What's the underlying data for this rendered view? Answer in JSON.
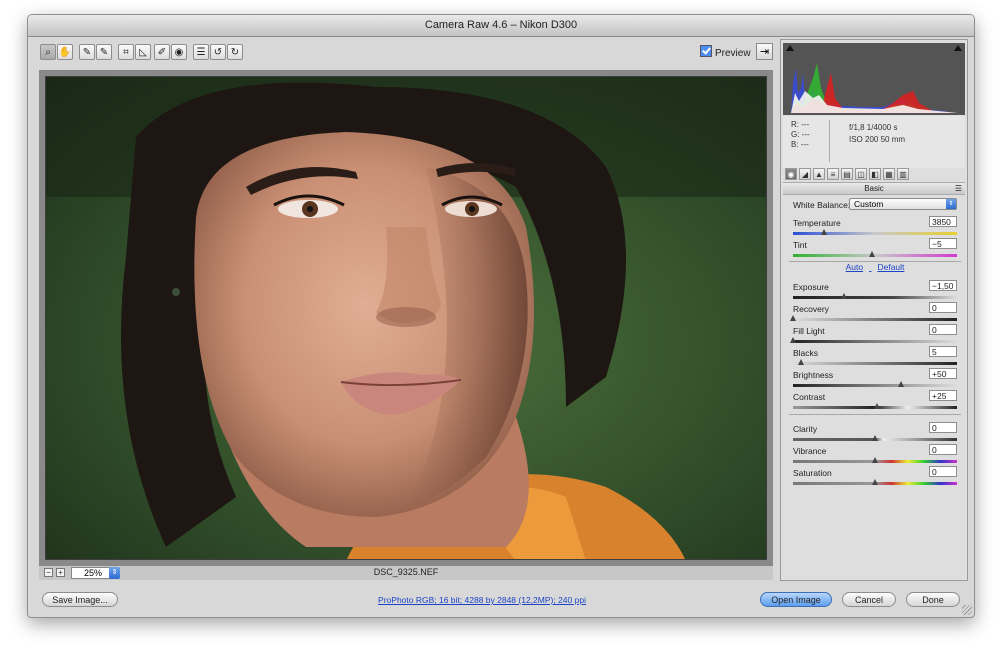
{
  "window": {
    "title": "Camera Raw 4.6  –  Nikon D300"
  },
  "toolbar": {
    "tools": [
      "zoom-icon",
      "hand-icon",
      "white-balance-icon",
      "color-sampler-icon",
      "crop-icon",
      "straighten-icon",
      "spot-removal-icon",
      "red-eye-icon",
      "preferences-icon",
      "rotate-left-icon",
      "rotate-right-icon"
    ],
    "preview_label": "Preview",
    "preview_checked": true
  },
  "image": {
    "filename": "DSC_9325.NEF",
    "zoom": "25%",
    "zoom_minus": "−",
    "zoom_plus": "+"
  },
  "readout": {
    "r": "R:   ---",
    "g": "G:   ---",
    "b": "B:   ---",
    "aperture_shutter": "f/1,8    1/4000 s",
    "iso_lens": "ISO 200    50 mm"
  },
  "panel": {
    "title": "Basic",
    "white_balance_label": "White Balance:",
    "white_balance_value": "Custom",
    "auto_label": "Auto",
    "default_label": "Default",
    "sliders": {
      "temperature": {
        "label": "Temperature",
        "value": "3850",
        "pos": 0.19
      },
      "tint": {
        "label": "Tint",
        "value": "−5",
        "pos": 0.48
      },
      "exposure": {
        "label": "Exposure",
        "value": "−1,50",
        "pos": 0.31
      },
      "recovery": {
        "label": "Recovery",
        "value": "0",
        "pos": 0.0
      },
      "fill_light": {
        "label": "Fill Light",
        "value": "0",
        "pos": 0.0
      },
      "blacks": {
        "label": "Blacks",
        "value": "5",
        "pos": 0.05
      },
      "brightness": {
        "label": "Brightness",
        "value": "+50",
        "pos": 0.66
      },
      "contrast": {
        "label": "Contrast",
        "value": "+25",
        "pos": 0.51
      },
      "clarity": {
        "label": "Clarity",
        "value": "0",
        "pos": 0.5
      },
      "vibrance": {
        "label": "Vibrance",
        "value": "0",
        "pos": 0.5
      },
      "saturation": {
        "label": "Saturation",
        "value": "0",
        "pos": 0.5
      }
    }
  },
  "footer": {
    "save_label": "Save Image...",
    "info_link": "ProPhoto RGB; 16 bit; 4288 by 2848 (12,2MP); 240 ppi",
    "open_label": "Open Image",
    "cancel_label": "Cancel",
    "done_label": "Done"
  },
  "colors": {
    "accent": "#3d7de8",
    "link": "#1c44c6"
  }
}
